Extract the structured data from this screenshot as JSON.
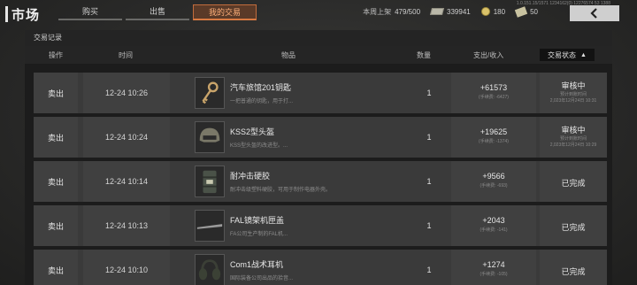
{
  "header": {
    "title": "市场",
    "tabs": [
      {
        "label": "购买",
        "active": false
      },
      {
        "label": "出售",
        "active": false
      },
      {
        "label": "我的交易",
        "active": true
      }
    ],
    "weekly_listing_label": "本周上架",
    "weekly_listing_value": "479/500",
    "cash_value": "339941",
    "coin_value": "180",
    "ticket_value": "50",
    "tiny_info": "1.0.151.15/1571 1234162(0) 12276574 53 1388",
    "back_icon": "chevron-left-icon"
  },
  "panel": {
    "title": "交易记录",
    "columns": {
      "action": "操作",
      "time": "时间",
      "item": "物品",
      "qty": "数量",
      "money": "支出/收入",
      "status": "交易状态"
    }
  },
  "rows": [
    {
      "action": "卖出",
      "time": "12-24 10:26",
      "icon": "key-icon",
      "name": "汽车旅馆201钥匙",
      "desc": "一把普通的钥匙，用于打...",
      "qty": "1",
      "amount": "+61573",
      "fee": "(手续费: -6427)",
      "status": "审核中",
      "status_sub1": "预计到账时间",
      "status_sub2": "2,023年12月24日 10:31"
    },
    {
      "action": "卖出",
      "time": "12-24 10:24",
      "icon": "helmet-icon",
      "name": "KSS2型头盔",
      "desc": "KSS型头盔的改进型。...",
      "qty": "1",
      "amount": "+19625",
      "fee": "(手续费: -1374)",
      "status": "审核中",
      "status_sub1": "预计到账时间",
      "status_sub2": "2,023年12月24日 10:29"
    },
    {
      "action": "卖出",
      "time": "12-24 10:14",
      "icon": "barrel-icon",
      "name": "耐冲击硬胶",
      "desc": "耐冲击级塑料硬胶，可用于制作电器外壳。",
      "qty": "1",
      "amount": "+9566",
      "fee": "(手续费: -693)",
      "status": "已完成",
      "status_sub1": "",
      "status_sub2": ""
    },
    {
      "action": "卖出",
      "time": "12-24 10:13",
      "icon": "rifle-part-icon",
      "name": "FAL镜架机匣盖",
      "desc": "FA公司生产制的FAL机...",
      "qty": "1",
      "amount": "+2043",
      "fee": "(手续费: -141)",
      "status": "已完成",
      "status_sub1": "",
      "status_sub2": ""
    },
    {
      "action": "卖出",
      "time": "12-24 10:10",
      "icon": "headset-icon",
      "name": "Com1战术耳机",
      "desc": "国际装备公司出品的拾音...",
      "qty": "1",
      "amount": "+1274",
      "fee": "(手续费: -105)",
      "status": "已完成",
      "status_sub1": "",
      "status_sub2": ""
    }
  ]
}
